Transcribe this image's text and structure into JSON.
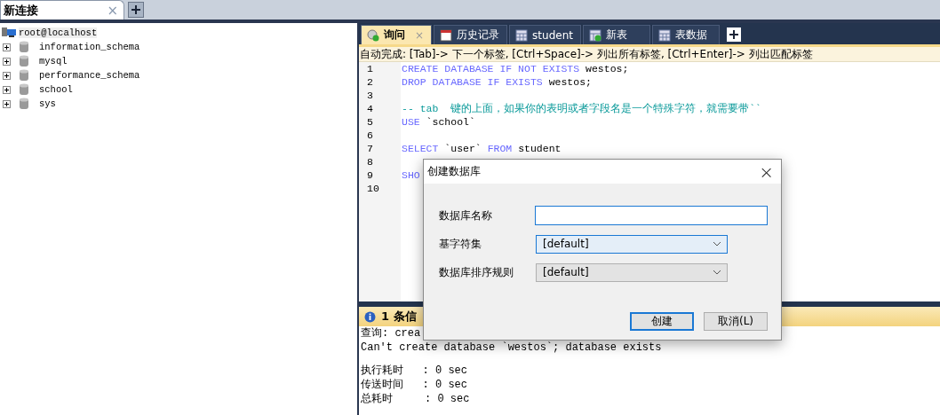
{
  "connection_tabs": [
    {
      "label": "新连接",
      "selected": true,
      "close": "×"
    }
  ],
  "tree": {
    "root": "root@localhost",
    "children": [
      {
        "name": "information_schema",
        "expanded": false
      },
      {
        "name": "mysql",
        "expanded": false
      },
      {
        "name": "performance_schema",
        "expanded": false
      },
      {
        "name": "school",
        "expanded": false
      },
      {
        "name": "sys",
        "expanded": false
      }
    ]
  },
  "query_tabs": [
    {
      "label": "询问",
      "kind": "query",
      "selected": true,
      "close": "×"
    },
    {
      "label": "历史记录",
      "kind": "history",
      "selected": false
    },
    {
      "label": "student",
      "kind": "table",
      "selected": false
    },
    {
      "label": "新表",
      "kind": "newtable",
      "selected": false
    },
    {
      "label": "表数据",
      "kind": "table",
      "selected": false
    }
  ],
  "autocomplete_hint": "自动完成: [Tab]-> 下一个标签, [Ctrl+Space]-> 列出所有标签, [Ctrl+Enter]-> 列出匹配标签",
  "editor_lines": [
    {
      "number": "1",
      "tokens": [
        {
          "kind": "keyword",
          "text": "CREATE DATABASE IF NOT EXISTS"
        },
        {
          "kind": "text",
          "text": " westos;"
        }
      ]
    },
    {
      "number": "2",
      "tokens": [
        {
          "kind": "keyword",
          "text": "DROP DATABASE IF EXISTS"
        },
        {
          "kind": "text",
          "text": " westos;"
        }
      ]
    },
    {
      "number": "3"
    },
    {
      "number": "4",
      "tokens": [
        {
          "kind": "comment",
          "text": "-- tab  键的上面，如果你的表明或者字段名是一个特殊字符，就需要带``"
        }
      ]
    },
    {
      "number": "5",
      "tokens": [
        {
          "kind": "keyword",
          "text": "USE"
        },
        {
          "kind": "text",
          "text": " `school`"
        }
      ]
    },
    {
      "number": "6"
    },
    {
      "number": "7",
      "tokens": [
        {
          "kind": "keyword",
          "text": "SELECT"
        },
        {
          "kind": "text",
          "text": " `user` "
        },
        {
          "kind": "keyword",
          "text": "FROM"
        },
        {
          "kind": "text",
          "text": " student"
        }
      ]
    },
    {
      "number": "8"
    },
    {
      "number": "9",
      "tokens": [
        {
          "kind": "keyword",
          "text": "SHO"
        }
      ]
    },
    {
      "number": "10"
    }
  ],
  "messages": {
    "title": "1 条信",
    "lines": [
      "查询: crea",
      "Can't create database `westos`; database exists"
    ],
    "stats": [
      "执行耗时   : 0 sec",
      "传送时间   : 0 sec",
      "总耗时     : 0 sec"
    ]
  },
  "dialog": {
    "title": "创建数据库",
    "close": "×",
    "fields": [
      {
        "label": "数据库名称",
        "kind": "input"
      },
      {
        "label": "基字符集",
        "kind": "select",
        "value": "[default]",
        "focused": true
      },
      {
        "label": "数据库排序规则",
        "kind": "select",
        "value": "[default]",
        "focused": false
      }
    ],
    "buttons": [
      {
        "label": "创建",
        "default": true
      },
      {
        "label": "取消(L)",
        "default": false
      }
    ]
  }
}
